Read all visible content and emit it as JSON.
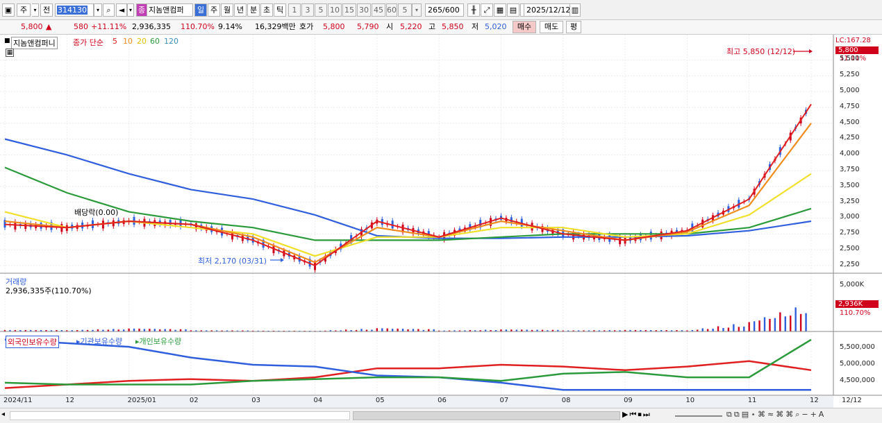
{
  "toolbar": {
    "market": "주",
    "prev": "전",
    "code": "314130",
    "name_badge": "종",
    "stock_name": "지놈앤컴퍼",
    "periods": [
      "일",
      "주",
      "월",
      "년",
      "분",
      "초",
      "틱"
    ],
    "minute_values": [
      "1",
      "3",
      "5",
      "10",
      "15",
      "30",
      "45",
      "60"
    ],
    "interval": "5",
    "count": "265",
    "count_max": "/600",
    "date": "2025/12/12"
  },
  "quote": {
    "price": "5,800",
    "arrow": "▲",
    "change": "580",
    "change_pct": "+11.11%",
    "volume": "2,936,335",
    "volume_pct": "110.70%",
    "turnover": "9.14%",
    "amount": "16,329백만",
    "hoga_label": "호가",
    "ask": "5,800",
    "bid": "5,790",
    "open_label": "시",
    "open": "5,220",
    "high_label": "고",
    "high": "5,850",
    "low_label": "저",
    "low": "5,020",
    "buy_label": "매수",
    "sell_label": "매도",
    "flat_label": "평"
  },
  "price_legend": {
    "name": "지놈앤컴퍼니",
    "title": "종가 단순",
    "mas": [
      "5",
      "10",
      "20",
      "60",
      "120"
    ]
  },
  "ma_colors": {
    "5": "#e02020",
    "10": "#f08c1e",
    "20": "#f0e02a",
    "60": "#2a9a3a",
    "120": "#2f5fdc"
  },
  "annotations": {
    "high": "최고 5,850 (12/12)",
    "low": "최저 2,170 (03/31)",
    "dividend": "배당락(0.00)"
  },
  "price_axis": {
    "lc": "LC:167.28",
    "current": "5,800",
    "current_pct": "11.11%",
    "ticks": [
      "5,500",
      "5,250",
      "5,000",
      "4,750",
      "4,500",
      "4,250",
      "4,000",
      "3,750",
      "3,500",
      "3,250",
      "3,000",
      "2,750",
      "2,500",
      "2,250"
    ]
  },
  "volume_pane": {
    "title": "거래량",
    "value": "2,936,335주(110.70%)",
    "axis_top": "5,000K",
    "current": "2,936K",
    "current_pct": "110.70%"
  },
  "holdings_pane": {
    "series": [
      "외국인보유수량",
      "기관보유수량",
      "개인보유수량"
    ],
    "colors": [
      "#e02020",
      "#2f5fdc",
      "#2a9a3a"
    ],
    "ticks": [
      "5,500,000",
      "5,000,000",
      "4,500,000"
    ]
  },
  "x_axis": [
    "2024/11",
    "12",
    "2025/01",
    "02",
    "03",
    "04",
    "05",
    "06",
    "07",
    "08",
    "09",
    "10",
    "11",
    "12"
  ],
  "x_axis_right": "12/12",
  "chart_data": {
    "type": "line",
    "x": [
      "2024/11",
      "12",
      "2025/01",
      "02",
      "03",
      "04",
      "05",
      "06",
      "07",
      "08",
      "09",
      "10",
      "11",
      "12"
    ],
    "series": [
      {
        "name": "5",
        "values": [
          2900,
          2850,
          2950,
          2900,
          2650,
          2250,
          2950,
          2700,
          3000,
          2750,
          2650,
          2800,
          3300,
          4800
        ]
      },
      {
        "name": "10",
        "values": [
          2950,
          2850,
          2950,
          2900,
          2700,
          2300,
          2850,
          2700,
          2950,
          2800,
          2650,
          2780,
          3200,
          4500
        ]
      },
      {
        "name": "20",
        "values": [
          3100,
          2850,
          2950,
          2850,
          2750,
          2400,
          2700,
          2700,
          2850,
          2850,
          2700,
          2750,
          3050,
          3700
        ]
      },
      {
        "name": "60",
        "values": [
          3800,
          3400,
          3100,
          2950,
          2850,
          2650,
          2650,
          2650,
          2700,
          2750,
          2750,
          2750,
          2850,
          3150
        ]
      },
      {
        "name": "120",
        "values": [
          4250,
          4000,
          3700,
          3450,
          3300,
          3050,
          2720,
          2680,
          2680,
          2700,
          2700,
          2720,
          2800,
          2950
        ]
      },
      {
        "name": "거래량",
        "values": [
          150,
          120,
          300,
          120,
          80,
          60,
          330,
          90,
          200,
          100,
          150,
          110,
          950,
          2936
        ]
      },
      {
        "name": "외국인보유수량",
        "values": [
          4350000,
          4450000,
          4550000,
          4600000,
          4550000,
          4650000,
          4900000,
          4900000,
          5000000,
          4950000,
          4850000,
          4950000,
          5100000,
          4850000
        ]
      },
      {
        "name": "기관보유수량",
        "values": [
          5700000,
          5600000,
          5500000,
          5200000,
          5000000,
          4950000,
          4700000,
          4650000,
          4500000,
          4300000,
          4300000,
          4300000,
          4300000,
          4300000
        ]
      },
      {
        "name": "개인보유수량",
        "values": [
          4500000,
          4450000,
          4450000,
          4450000,
          4550000,
          4600000,
          4650000,
          4650000,
          4550000,
          4750000,
          4800000,
          4650000,
          4650000,
          5700000
        ]
      }
    ],
    "ylim": [
      2150,
      5900
    ]
  }
}
